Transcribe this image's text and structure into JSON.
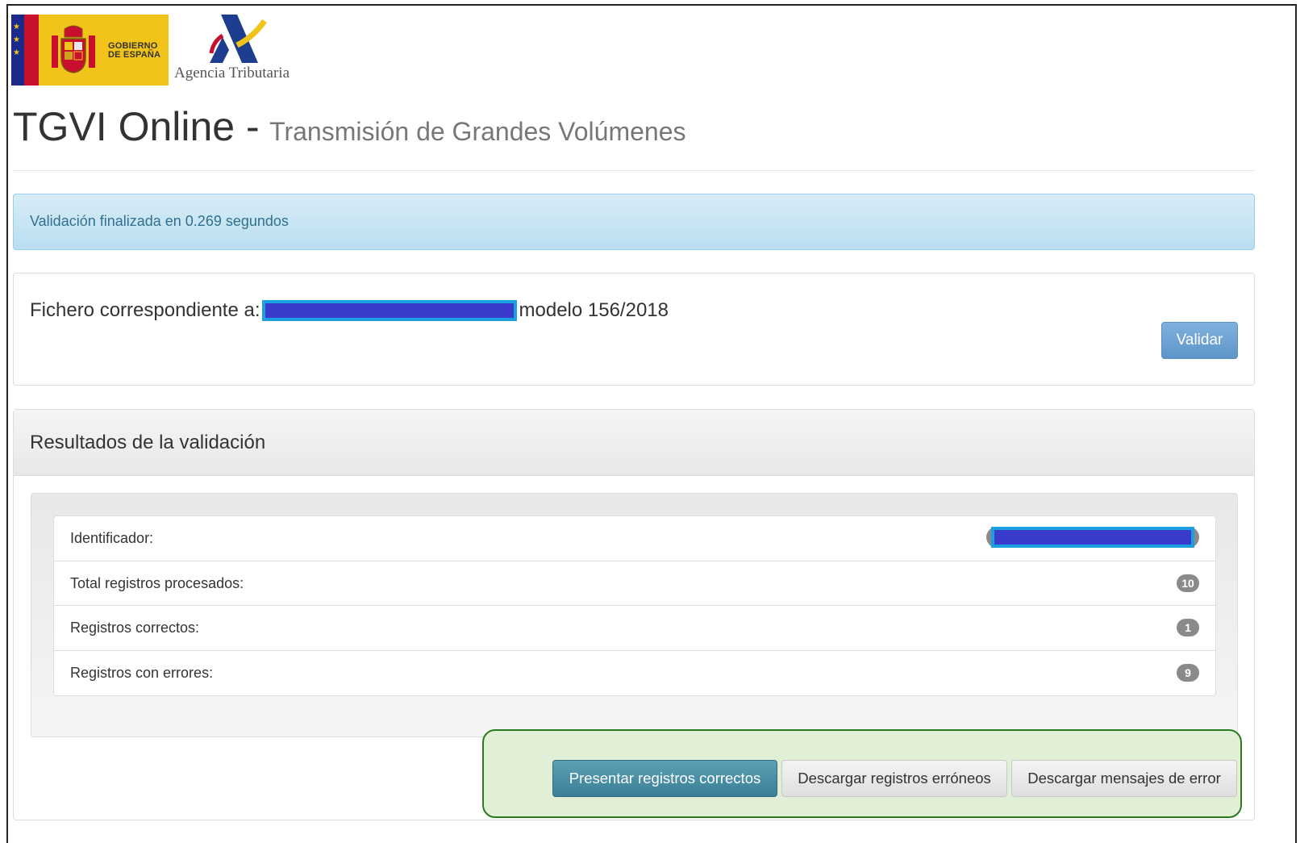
{
  "header": {
    "gov_logo_text": "GOBIERNO DE ESPAÑA",
    "agency_name": "Agencia Tributaria"
  },
  "page": {
    "title_main": "TGVI Online -",
    "title_sub": "Transmisión de Grandes Volúmenes"
  },
  "alert": {
    "message": "Validación finalizada en 0.269 segundos"
  },
  "file_panel": {
    "label": "Fichero correspondiente a:",
    "suffix": "modelo 156/2018",
    "validate_button": "Validar"
  },
  "results": {
    "heading": "Resultados de la validación",
    "rows": [
      {
        "label": "Identificador:",
        "value": ""
      },
      {
        "label": "Total registros procesados:",
        "value": "10"
      },
      {
        "label": "Registros correctos:",
        "value": "1"
      },
      {
        "label": "Registros con errores:",
        "value": "9"
      }
    ]
  },
  "actions": {
    "submit_correct": "Presentar registros correctos",
    "download_errors": "Descargar registros erróneos",
    "download_messages": "Descargar mensajes de error"
  },
  "colors": {
    "alert_bg": "#d9edf7",
    "alert_text": "#31708f",
    "primary_button": "#3a7f96",
    "validate_button": "#6fa3d4",
    "highlight_box": "#e2efd7",
    "highlight_border": "#2b7a1e",
    "redaction": "#3a3acd"
  }
}
